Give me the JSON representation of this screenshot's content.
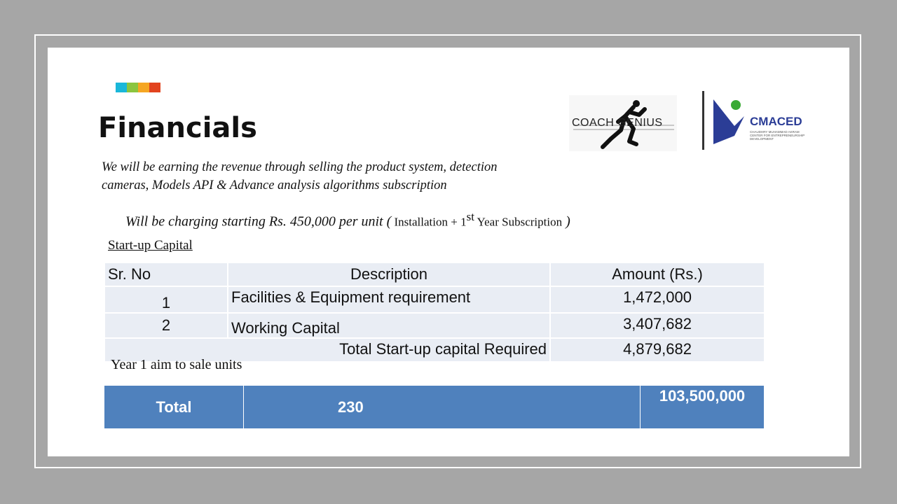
{
  "colors": {
    "frame_bg": "#a6a6a6",
    "slide_bg": "#ffffff",
    "accent_bars": [
      "#1ab7d9",
      "#8bc53f",
      "#f5a623",
      "#e2431e"
    ],
    "table_light": "#e9edf4",
    "table_blue": "#4f81bd",
    "cmaced_blue": "#2b3d96",
    "cmaced_green": "#3aaa35"
  },
  "slide": {
    "title": "Financials",
    "intro_line1": "We will be earning the revenue through selling the product system, detection",
    "intro_line2": "cameras, Models API & Advance analysis algorithms subscription",
    "pricing": {
      "prefix": "Will be charging starting Rs. 450,000 per unit (",
      "detail_before_sup": " Installation + 1",
      "sup": "st",
      "detail_after_sup": " Year Subscription",
      "suffix": " )"
    },
    "capital_heading": "Start-up Capital",
    "aim_text": "Year 1 aim to sale units"
  },
  "logos": {
    "coach_genius_text": "COACH GENIUS",
    "cmaced_name": "CMACED",
    "cmaced_subtitle": "CHAUDHRY MUHAMMAD AKRAM CENTER FOR ENTREPRENEURSHIP DEVELOPMENT"
  },
  "capital_table": {
    "headers": [
      "Sr. No",
      "Description",
      "Amount (Rs.)"
    ],
    "rows": [
      {
        "no": "1",
        "description": "Facilities & Equipment requirement",
        "amount": "1,472,000"
      },
      {
        "no": "2",
        "description": "Working Capital",
        "amount": "3,407,682"
      }
    ],
    "total_label": "Total Start-up capital Required",
    "total_amount": "4,879,682"
  },
  "totals_row": {
    "label": "Total",
    "units": "230",
    "revenue": "103,500,000"
  }
}
